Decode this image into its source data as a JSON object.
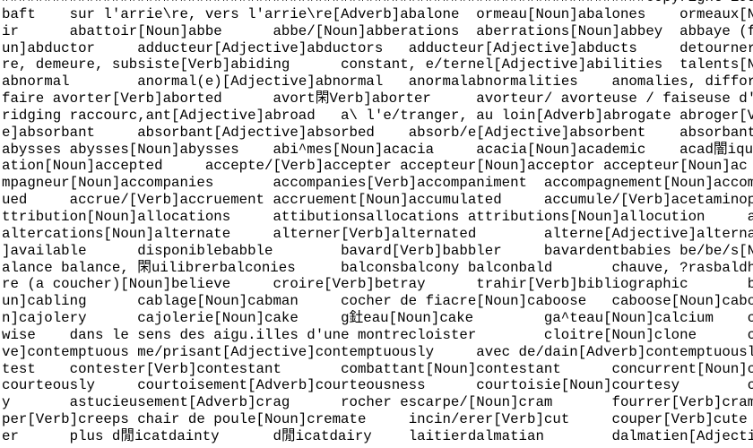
{
  "document": {
    "lines": [
      "############################################################################Copyright 199",
      "baft\tsur l'arrie\\re, vers l'arrie\\re[Adverb]abalone\tormeau[Noun]abalones\tormeaux[N",
      "ir\tabattoir[Noun]abbe\tabbe/[Noun]abberations\taberrations[Noun]abbey\tabbaye (f",
      "un]abductor\tadducteur[Adjective]abductors\tadducteur[Adjective]abducts\tdetourner",
      "re, demeure, subsiste[Verb]abiding\tconstant, e/ternel[Adjective]abilities\ttalents[N",
      "abnormal\tanormal(e)[Adjective]abnormal\tanormalabnormalities\tanomalies, diffor",
      "faire avorter[Verb]aborted\tavort閑Verb]aborter\tavorteur/ avorteuse / faiseuse d'",
      "ridging raccourc,ant[Adjective]abroad\ta\\ l'e/tranger, au loin[Adverb]abrogate abroger[V",
      "e]absorbant\tabsorbant[Adjective]absorbed\tabsorb/e[Adjective]absorbent\tabsorbant",
      "abysses abysses[Noun]abysses\tabi^mes[Noun]acacia\tacacia[Noun]academic\tacad闇iqu",
      "ation[Noun]accepted\taccepte/[Verb]accepter accepteur[Noun]acceptor accepteur[Noun]ac",
      "mpagneur[Noun]accompanies\taccompanies[Verb]accompaniment\taccompagnement[Noun]accom",
      "ued\taccrue/[Verb]accruement accruement[Noun]accumulated\taccumule/[Verb]acetaminop",
      "ttribution[Noun]allocations\tattibutionsallocations attributions[Noun]allocution\ta",
      "altercations[Noun]alternate\talterner[Verb]alternated\talterne[Adjective]alterna",
      "]available\tdisponiblebabble\tbavard[Verb]babbler\tbavardentbabies be/be/s[N",
      "alance balance, 閑uilibrerbalconies\tbalconsbalcony balconbald\tchauve, ?rasbaldh",
      "re (a coucher)[Noun]believe\tcroire[Verb]betray\ttrahir[Verb]bibliographic\tb",
      "un]cabling\tcablage[Noun]cabman\tcocher de fiacre[Noun]caboose\tcaboose[Noun]cabo",
      "n]cajolery\tcajolerie[Noun]cake\tg釷eau[Noun]cake\tga^teau[Noun]calcium\tc",
      "wise\tdans le sens des aigu.illes d'une montrecloister\tcloitre[Noun]clone\tc",
      "ve]contemptuous me/prisant[Adjective]contemptuously\tavec de/dain[Adverb]contemptuousl",
      "test\tcontester[Verb]contestant\tcombattant[Noun]contestant\tconcurrent[Noun]c",
      "courteously\tcourtoisement[Adverb]courteousness\tcourtoisie[Noun]courtesy\tc",
      "y\tastucieusement[Adverb]crag\trocher escarpe/[Noun]cram\tfourrer[Verb]cram",
      "per[Verb]creeps chair de poule[Noun]cremate\tincin/erer[Verb]cut\tcouper[Verb]cute",
      "er\tplus d閒icatdainty\td閒icatdairy\tlaitierdalmatian\tdalmatien[Adjecti"
    ]
  }
}
